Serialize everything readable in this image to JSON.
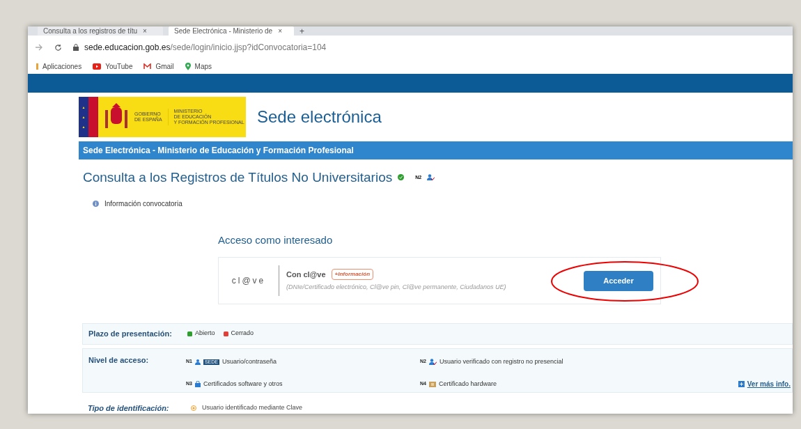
{
  "browser": {
    "tabs": [
      {
        "title": "Consulta a los registros de títu",
        "selected": false
      },
      {
        "title": "Sede Electrónica - Ministerio de",
        "selected": true
      }
    ],
    "new_tab": "+",
    "close": "×",
    "url": {
      "host": "sede.educacion.gob.es",
      "path": "/sede/login/inicio.jjsp?idConvocatoria=104"
    },
    "bookmarks": [
      {
        "label": "Aplicaciones",
        "kind": "apps"
      },
      {
        "label": "YouTube",
        "kind": "youtube"
      },
      {
        "label": "Gmail",
        "kind": "gmail"
      },
      {
        "label": "Maps",
        "kind": "maps"
      }
    ]
  },
  "logo": {
    "gov": [
      "GOBIERNO",
      "DE ESPAÑA"
    ],
    "ministry": [
      "MINISTERIO",
      "DE EDUCACIÓN",
      "Y FORMACIÓN PROFESIONAL"
    ]
  },
  "site_title": "Sede electrónica",
  "nav_bar": "Sede Electrónica - Ministerio de Educación y Formación Profesional",
  "page_title": "Consulta a los Registros de Títulos No Universitarios",
  "title_level": "N2",
  "info_link": "Información convocatoria",
  "access": {
    "heading": "Acceso como interesado",
    "logo": "cl@ve",
    "method": "Con cl@ve",
    "more": "+Información",
    "description": "(DNIe/Certificado electrónico, Cl@ve pin, Cl@ve permanente, Ciudadanos UE)",
    "button": "Acceder",
    "highlighted": true
  },
  "deadline": {
    "label": "Plazo de presentación:",
    "states": [
      {
        "label": "Abierto",
        "color": "#2e9e2e"
      },
      {
        "label": "Cerrado",
        "color": "#e0403a"
      }
    ]
  },
  "levels": {
    "label": "Nivel de acceso:",
    "items": [
      {
        "code": "N1",
        "text": "Usuario/contraseña",
        "badge": "SEDE"
      },
      {
        "code": "N2",
        "text": "Usuario verificado con registro no presencial"
      },
      {
        "code": "N3",
        "text": "Certificados software y otros"
      },
      {
        "code": "N4",
        "text": "Certificado hardware"
      }
    ],
    "more": "Ver más info."
  },
  "identification": {
    "label": "Tipo de identificación:",
    "value": "Usuario identificado mediante Clave"
  }
}
